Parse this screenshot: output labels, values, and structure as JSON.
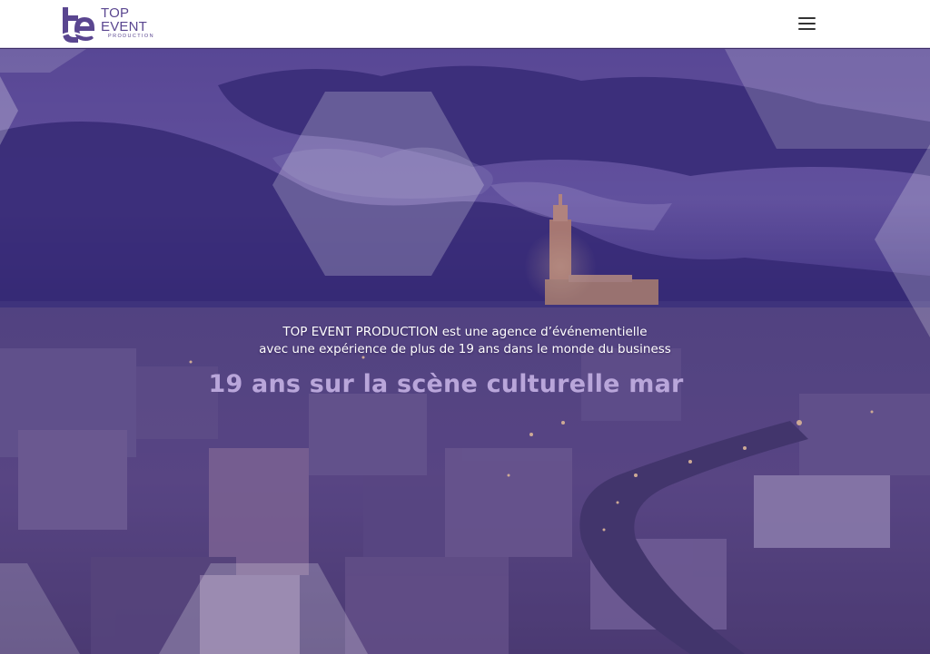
{
  "brand": {
    "logo_monogram": "te",
    "logo_line1": "TOP",
    "logo_line2": "EVENT",
    "logo_line3": "PRODUCTION",
    "color": "#5a4690"
  },
  "nav": {
    "menu_icon": "hamburger-menu-icon"
  },
  "hero": {
    "tagline_line1": "TOP EVENT PRODUCTION est une agence d’événementielle",
    "tagline_line2": "avec une expérience de plus de 19 ans dans le monde du business",
    "headline": "19 ans sur la scène culturelle mar",
    "overlay_color": "#4a3a8a",
    "headline_color": "#b9a6da"
  }
}
